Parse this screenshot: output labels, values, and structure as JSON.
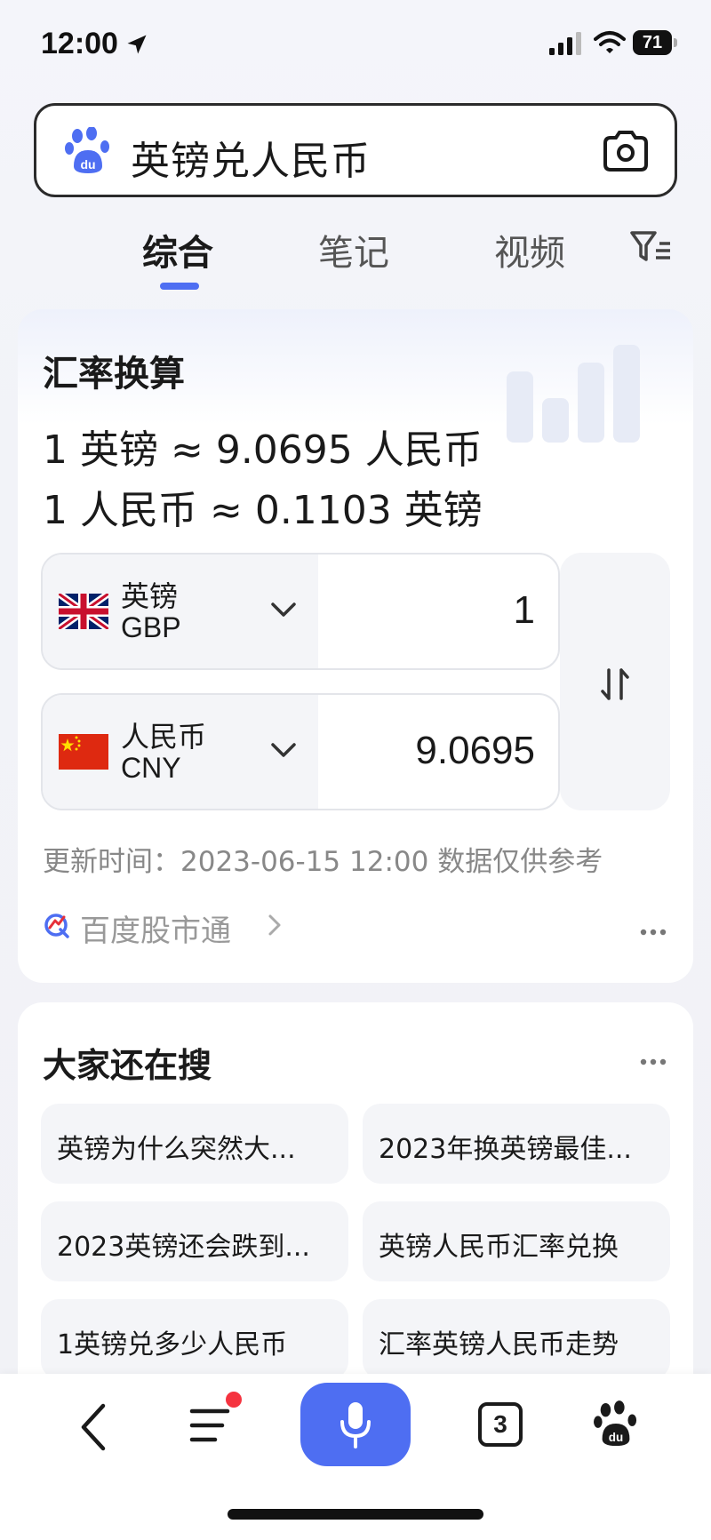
{
  "status_bar": {
    "time": "12:00",
    "battery": "71"
  },
  "search": {
    "query": "英镑兑人民币"
  },
  "tabs": [
    {
      "label": "综合",
      "active": true
    },
    {
      "label": "笔记",
      "active": false
    },
    {
      "label": "视频",
      "active": false
    }
  ],
  "exchange_card": {
    "title": "汇率换算",
    "rate_line_1": "1 英镑 ≈ 9.0695 人民币",
    "rate_line_2": "1 人民币 ≈ 0.1103 英镑",
    "from": {
      "name": "英镑",
      "code": "GBP",
      "value": "1"
    },
    "to": {
      "name": "人民币",
      "code": "CNY",
      "value": "9.0695"
    },
    "update_text": "更新时间：2023-06-15 12:00 数据仅供参考",
    "source_label": "百度股市通"
  },
  "related": {
    "title": "大家还在搜",
    "items": [
      "英镑为什么突然大...",
      "2023年换英镑最佳...",
      "2023英镑还会跌到...",
      "英镑人民币汇率兑换",
      "1英镑兑多少人民币",
      "汇率英镑人民币走势"
    ]
  },
  "bottom_nav": {
    "tab_count": "3"
  },
  "colors": {
    "accent": "#4e6ef2",
    "notification": "#f5333f"
  }
}
